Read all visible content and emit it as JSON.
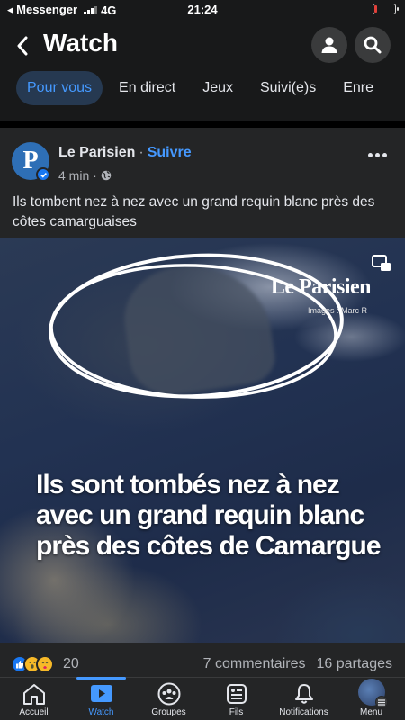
{
  "status_bar": {
    "carrier": "◂ Messenger",
    "network": "4G",
    "time": "21:24"
  },
  "header": {
    "title": "Watch"
  },
  "tabs": [
    {
      "label": "Pour vous",
      "active": true
    },
    {
      "label": "En direct",
      "active": false
    },
    {
      "label": "Jeux",
      "active": false
    },
    {
      "label": "Suivi(e)s",
      "active": false
    },
    {
      "label": "Enre",
      "active": false
    }
  ],
  "post": {
    "page_name": "Le Parisien",
    "separator": "·",
    "follow_label": "Suivre",
    "time": "4 min ·",
    "avatar_letter": "P",
    "caption": "Ils tombent nez à nez avec un grand requin blanc près des côtes camarguaises",
    "video": {
      "brand": "Le Parisien",
      "credit": "Images : Marc R",
      "overlay_lines": [
        "Ils sont tombés nez à nez",
        "avec un grand requin blanc",
        "près des côtes de Camargue"
      ]
    }
  },
  "reactions": {
    "count": "20",
    "comments": "7 commentaires",
    "shares": "16 partages"
  },
  "bottom_nav": [
    {
      "label": "Accueil",
      "icon": "home-icon",
      "active": false
    },
    {
      "label": "Watch",
      "icon": "watch-icon",
      "active": true
    },
    {
      "label": "Groupes",
      "icon": "groups-icon",
      "active": false
    },
    {
      "label": "Fils",
      "icon": "feeds-icon",
      "active": false
    },
    {
      "label": "Notifications",
      "icon": "bell-icon",
      "active": false
    },
    {
      "label": "Menu",
      "icon": "menu-avatar",
      "active": false
    }
  ],
  "colors": {
    "accent": "#4599ff",
    "background": "#18191a",
    "card": "#242526"
  }
}
